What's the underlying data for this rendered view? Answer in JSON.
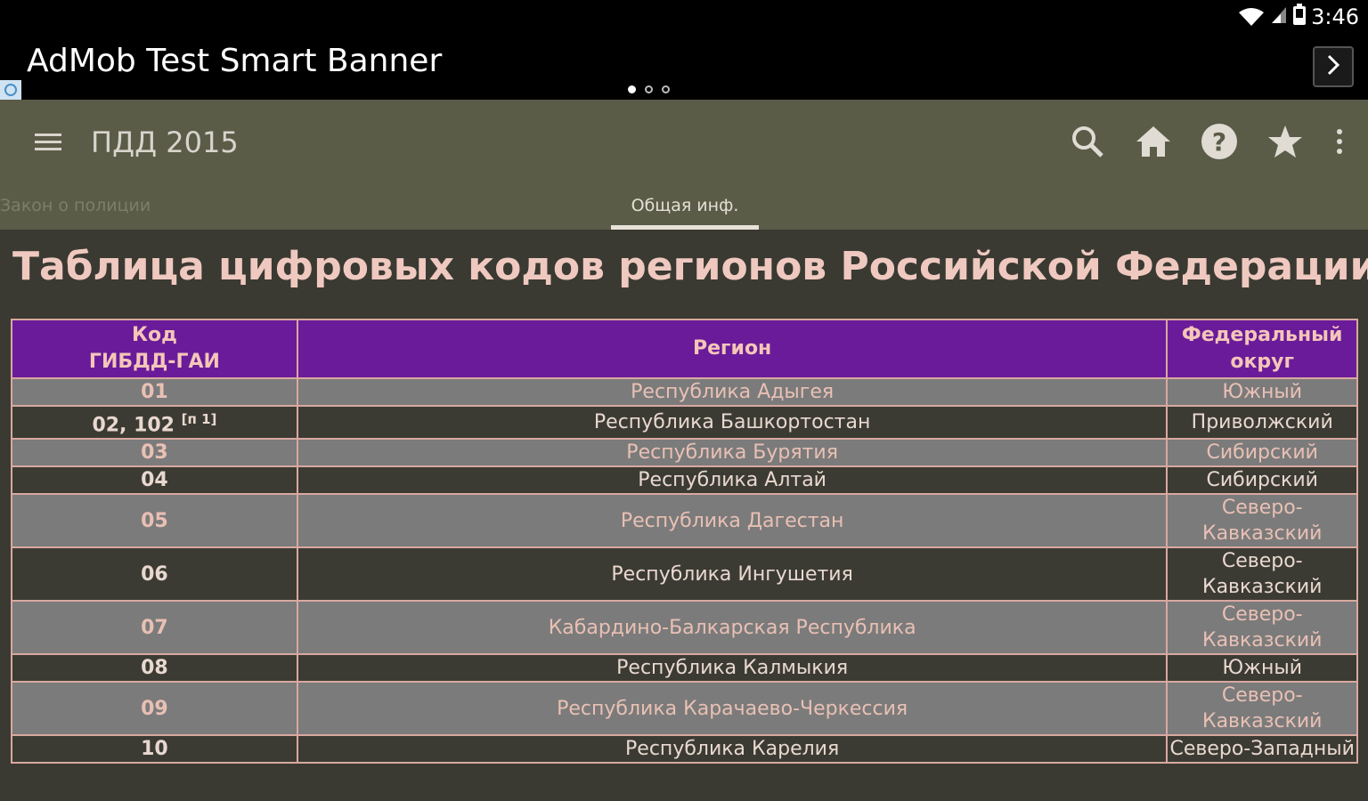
{
  "status_bar": {
    "time": "3:46"
  },
  "ad": {
    "title": "AdMob Test Smart Banner"
  },
  "toolbar": {
    "title": "ПДД 2015"
  },
  "tabs": {
    "left_label": "Закон о полиции",
    "active_label": "Общая инф."
  },
  "page": {
    "title": "Таблица цифровых кодов регионов Российской Федерации"
  },
  "table": {
    "headers": {
      "code_line1": "Код",
      "code_line2": "ГИБДД-ГАИ",
      "region": "Регион",
      "fd_line1": "Федеральный",
      "fd_line2": "округ"
    },
    "rows": [
      {
        "code": "01",
        "region": "Республика Адыгея",
        "fd": "Южный"
      },
      {
        "code": "02, 102",
        "note": "[п 1]",
        "region": "Республика Башкортостан",
        "fd": "Приволжский"
      },
      {
        "code": "03",
        "region": "Республика Бурятия",
        "fd": "Сибирский"
      },
      {
        "code": "04",
        "region": "Республика Алтай",
        "fd": "Сибирский"
      },
      {
        "code": "05",
        "region": "Республика Дагестан",
        "fd": "Северо-Кавказский"
      },
      {
        "code": "06",
        "region": "Республика Ингушетия",
        "fd": "Северо-Кавказский"
      },
      {
        "code": "07",
        "region": "Кабардино-Балкарская Республика",
        "fd": "Северо-Кавказский"
      },
      {
        "code": "08",
        "region": "Республика Калмыкия",
        "fd": "Южный"
      },
      {
        "code": "09",
        "region": "Республика Карачаево-Черкессия",
        "fd": "Северо-Кавказский"
      },
      {
        "code": "10",
        "region": "Республика Карелия",
        "fd": "Северо-Западный"
      }
    ]
  },
  "colors": {
    "toolbar": "#5a5c48",
    "header_bg": "#6a1b9a",
    "row_light": "#7b7b7b",
    "row_dark": "#3b3b33",
    "title_text": "#efc9c0"
  }
}
